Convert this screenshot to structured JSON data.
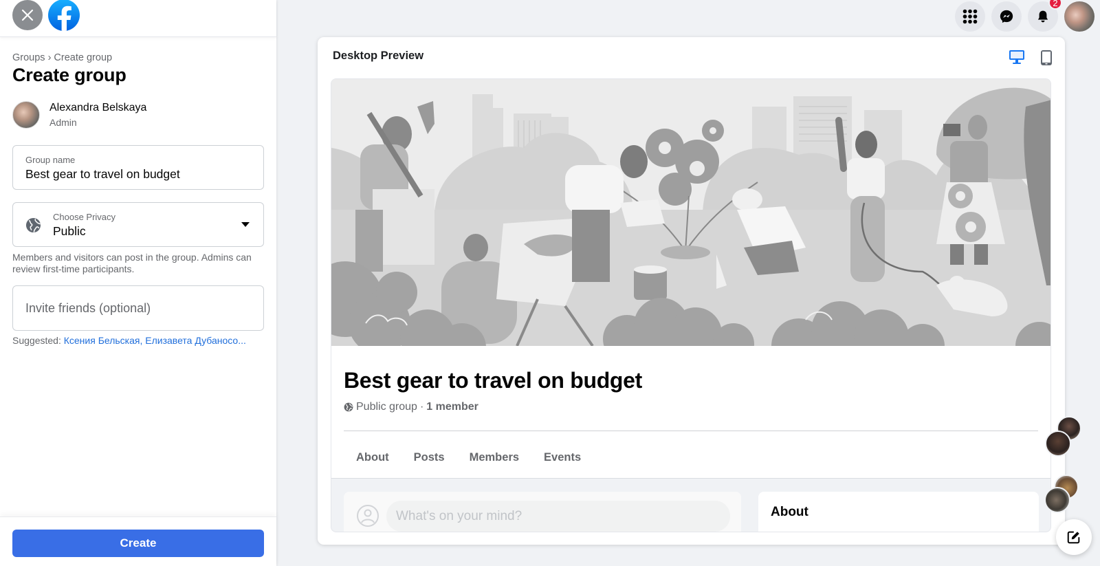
{
  "sidebar": {
    "breadcrumb": "Groups › Create group",
    "title": "Create group",
    "owner": {
      "name": "Alexandra Belskaya",
      "role": "Admin"
    },
    "group_name_field": {
      "label": "Group name",
      "value": "Best gear to travel on budget"
    },
    "privacy_field": {
      "label": "Choose Privacy",
      "value": "Public"
    },
    "privacy_help": "Members and visitors can post in the group. Admins can review first-time participants.",
    "invite_field": {
      "placeholder": "Invite friends (optional)",
      "value": ""
    },
    "suggested": {
      "label": "Suggested:",
      "names": [
        "Ксения Бельская,",
        "Елизавета Дубаносо..."
      ]
    },
    "create_label": "Create"
  },
  "topnav": {
    "icons": [
      "menu-grid-icon",
      "messenger-icon",
      "notifications-bell-icon"
    ],
    "notification_count": "2"
  },
  "preview": {
    "title": "Desktop Preview",
    "active_device": "desktop",
    "group_name": "Best gear to travel on budget",
    "privacy_text": "Public group",
    "separator": " · ",
    "member_text": "1 member",
    "tabs": [
      "About",
      "Posts",
      "Members",
      "Events"
    ],
    "composer_placeholder": "What's on your mind?",
    "about_title": "About"
  },
  "colors": {
    "accent": "#396ee6",
    "link": "#216fdb",
    "badge": "#e41e3f",
    "device_active": "#1877f2"
  }
}
